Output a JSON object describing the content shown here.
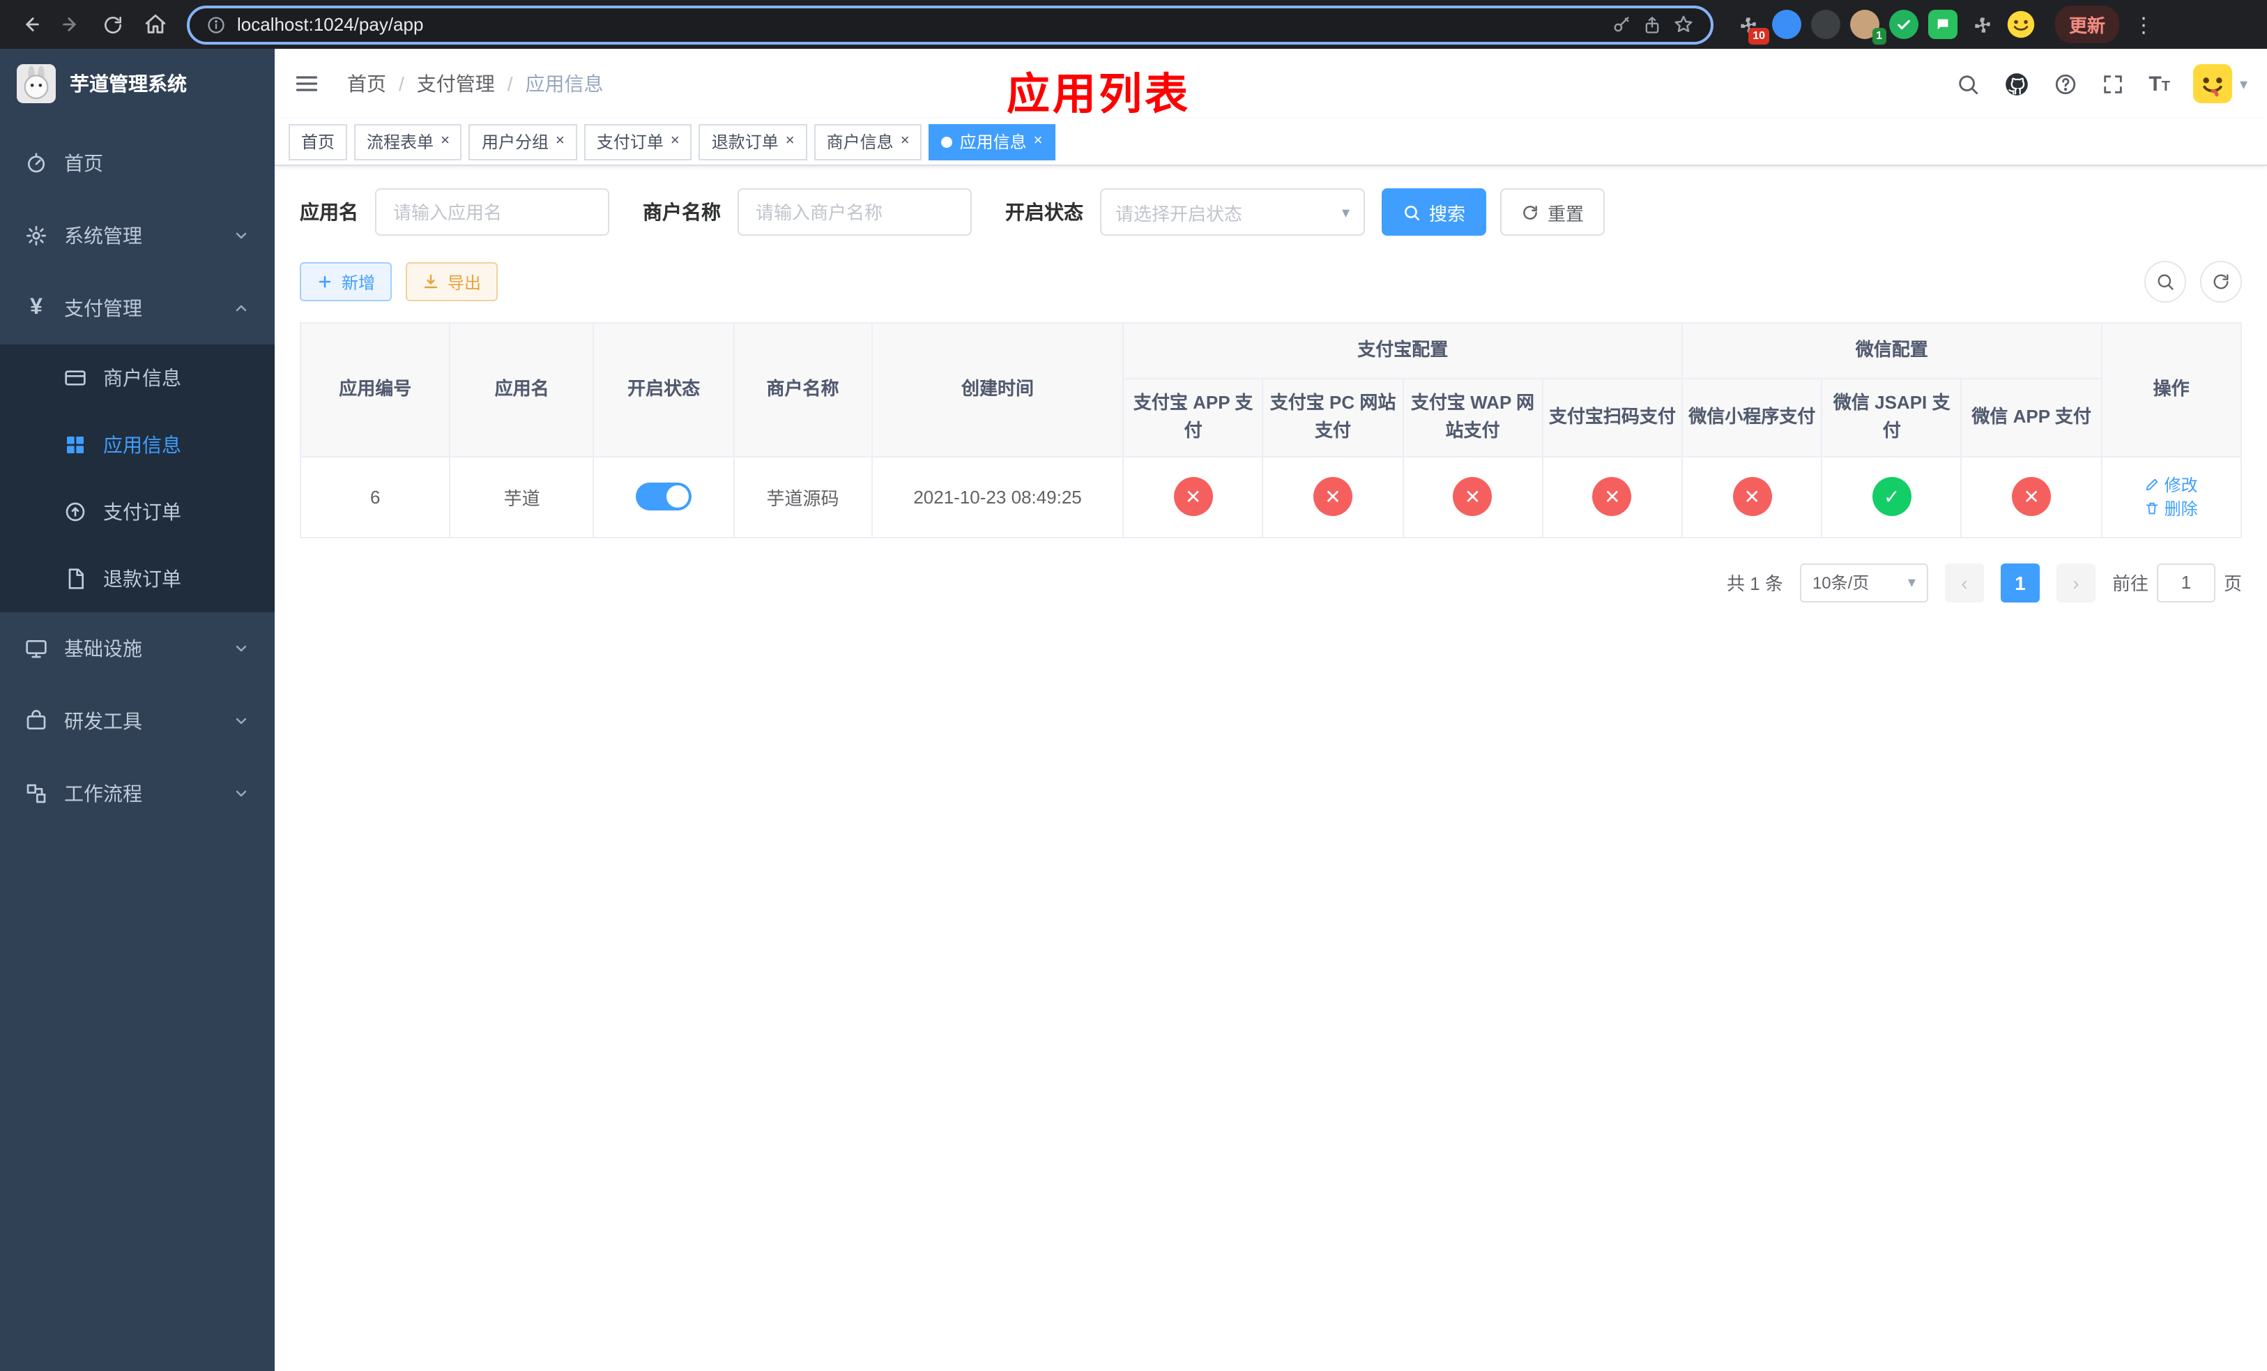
{
  "browser": {
    "url": "localhost:1024/pay/app",
    "update_label": "更新",
    "ext_badge_puzzle": "10",
    "ext_badge_avatar": "1"
  },
  "annotation": {
    "text": "应用列表",
    "color": "#ff0000"
  },
  "sidebar": {
    "title": "芋道管理系统",
    "items": {
      "home": "首页",
      "system": "系统管理",
      "payment": "支付管理",
      "merchant": "商户信息",
      "appinfo": "应用信息",
      "payorder": "支付订单",
      "refund": "退款订单",
      "infra": "基础设施",
      "devtools": "研发工具",
      "workflow": "工作流程"
    }
  },
  "header": {
    "breadcrumb": [
      "首页",
      "支付管理",
      "应用信息"
    ]
  },
  "tabs": [
    {
      "label": "首页"
    },
    {
      "label": "流程表单"
    },
    {
      "label": "用户分组"
    },
    {
      "label": "支付订单"
    },
    {
      "label": "退款订单"
    },
    {
      "label": "商户信息"
    },
    {
      "label": "应用信息"
    }
  ],
  "filters": {
    "app_name_label": "应用名",
    "app_name_placeholder": "请输入应用名",
    "merchant_label": "商户名称",
    "merchant_placeholder": "请输入商户名称",
    "status_label": "开启状态",
    "status_placeholder": "请选择开启状态",
    "search_label": "搜索",
    "reset_label": "重置"
  },
  "toolbar": {
    "add_label": "新增",
    "export_label": "导出"
  },
  "table": {
    "headers": {
      "app_id": "应用编号",
      "app_name": "应用名",
      "status": "开启状态",
      "merchant": "商户名称",
      "created": "创建时间",
      "alipay_group": "支付宝配置",
      "alipay_cols": [
        "支付宝 APP 支付",
        "支付宝 PC 网站支付",
        "支付宝 WAP 网站支付",
        "支付宝扫码支付"
      ],
      "wechat_group": "微信配置",
      "wechat_cols": [
        "微信小程序支付",
        "微信 JSAPI 支付",
        "微信 APP 支付"
      ],
      "ops": "操作"
    },
    "rows": [
      {
        "app_id": "6",
        "app_name": "芋道",
        "enabled": true,
        "merchant": "芋道源码",
        "created": "2021-10-23 08:49:25",
        "alipay_app": "disabled",
        "alipay_pc": "disabled",
        "alipay_wap": "disabled",
        "alipay_qr": "disabled",
        "wx_mini": "disabled",
        "wx_jsapi": "enabled",
        "wx_app": "disabled",
        "edit_label": "修改",
        "delete_label": "删除"
      }
    ]
  },
  "pagination": {
    "total": "共 1 条",
    "page_size": "10条/页",
    "prev_glyph": "‹",
    "next_glyph": "›",
    "current_page": "1",
    "goto_prefix": "前往",
    "goto_value": "1",
    "goto_suffix": "页"
  },
  "icons": {
    "tab_close": "×",
    "select_caret": "▾",
    "avatar_caret": "▾",
    "kebab": "⋮",
    "status_enabled_glyph": "✓",
    "status_disabled_glyph": "✕",
    "font_size_big": "T",
    "font_size_small": "T"
  }
}
